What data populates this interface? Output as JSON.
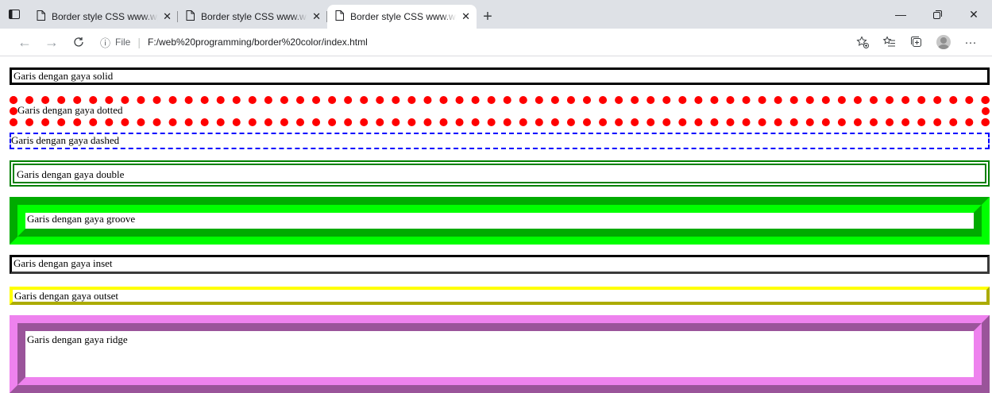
{
  "browser": {
    "tabs": [
      {
        "title": "Border style CSS www.wpm.manaj...",
        "active": false
      },
      {
        "title": "Border style CSS www.wpm.manaj...",
        "active": false
      },
      {
        "title": "Border style CSS www.wpm.manaj...",
        "active": true
      }
    ],
    "address": {
      "scheme": "File",
      "url": "F:/web%20programming/border%20color/index.html"
    },
    "icons": {
      "tab_actions": "tab-actions-icon",
      "favicon": "page-icon",
      "close": "close-icon",
      "new_tab": "plus-icon",
      "back": "back-arrow-icon",
      "forward": "forward-arrow-icon",
      "reload": "reload-icon",
      "info": "info-icon",
      "add_favorite": "add-favorite-icon",
      "favorites": "favorites-icon",
      "collections": "collections-icon",
      "profile": "avatar",
      "more": "more-icon"
    }
  },
  "page": {
    "boxes": [
      {
        "style": "solid",
        "color": "#000000",
        "text": "Garis dengan gaya solid"
      },
      {
        "style": "dotted",
        "color": "#ff0000",
        "text": "Garis dengan gaya dotted"
      },
      {
        "style": "dashed",
        "color": "#0000ff",
        "text": "Garis dengan gaya dashed"
      },
      {
        "style": "double",
        "color": "#008000",
        "text": "Garis dengan gaya double"
      },
      {
        "style": "groove",
        "color": "#00ff00",
        "text": "Garis dengan gaya groove"
      },
      {
        "style": "inset",
        "color": "#3a3a3a",
        "text": "Garis dengan gaya inset"
      },
      {
        "style": "outset",
        "color": "#ffff00",
        "text": "Garis dengan gaya outset"
      },
      {
        "style": "ridge",
        "color": "#ee82ee",
        "text": "Garis dengan gaya ridge"
      }
    ]
  }
}
